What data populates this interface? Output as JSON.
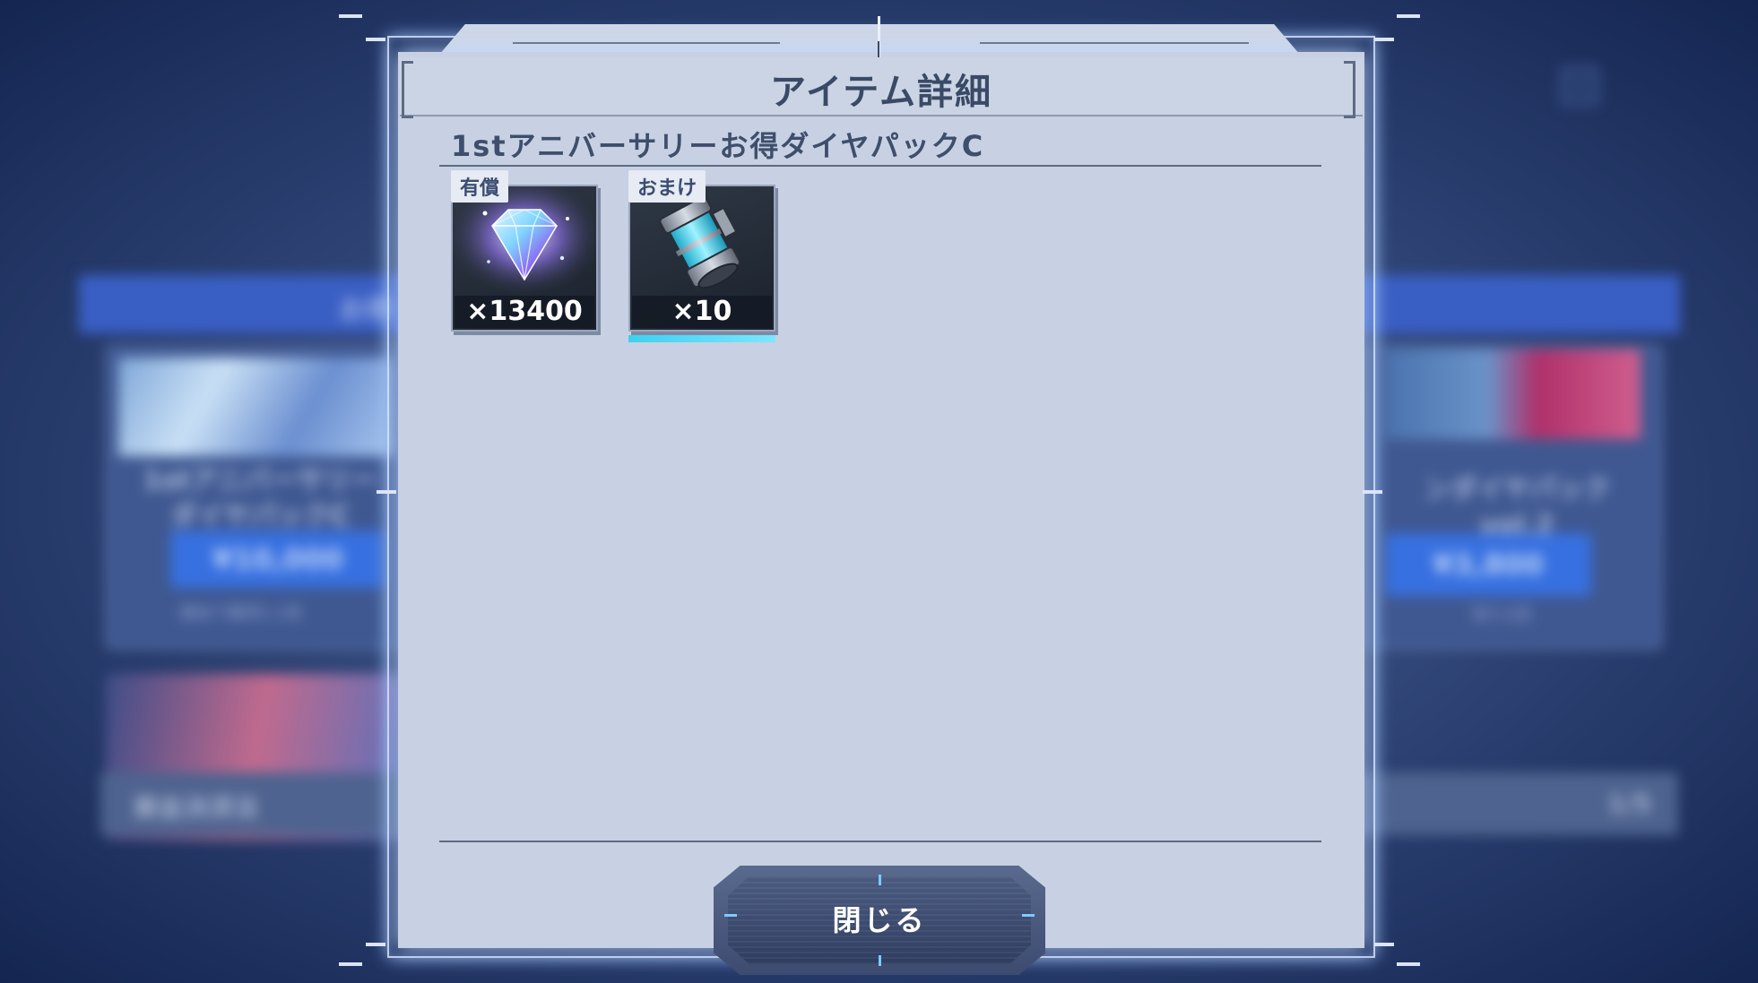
{
  "dialog": {
    "title": "アイテム詳細",
    "pack_name": "1stアニバーサリーお得ダイヤパックC",
    "items": [
      {
        "tag": "有償",
        "quantity": "×13400",
        "icon": "diamond-icon"
      },
      {
        "tag": "おまけ",
        "quantity": "×10",
        "icon": "energy-cylinder-icon"
      }
    ],
    "close_label": "閉じる"
  },
  "background": {
    "left_card": {
      "name": "1stアニバーサリー\nダイヤパックC",
      "price": "¥10,000",
      "note": "課金で獲得1:1倍"
    },
    "right_card": {
      "name": "ンダイヤパック vol.2",
      "price": "¥3,800",
      "note": "残り1回"
    },
    "header_text": "お得",
    "bottom_bar_text": "資金決済法",
    "bottom_bar_right": "1/5"
  }
}
